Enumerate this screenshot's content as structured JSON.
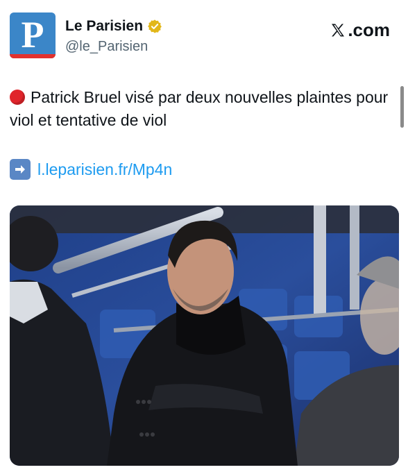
{
  "account": {
    "name": "Le Parisien",
    "handle": "@le_Parisien",
    "avatar_letter": "P",
    "verified_icon": "gold-verified-badge"
  },
  "brand": {
    "logo_text": ".com",
    "logo_icon": "x-logo-icon"
  },
  "post": {
    "status_icon": "red-circle-icon",
    "text": "Patrick Bruel visé par deux nouvelles plaintes pour viol et tentative de viol",
    "link_icon": "right-arrow-icon",
    "link": "l.leparisien.fr/Mp4n"
  },
  "colors": {
    "avatar_blue": "#3b86c8",
    "avatar_red": "#e2312d",
    "link_blue": "#1d9bf0",
    "verified_gold": "#e2b719"
  }
}
